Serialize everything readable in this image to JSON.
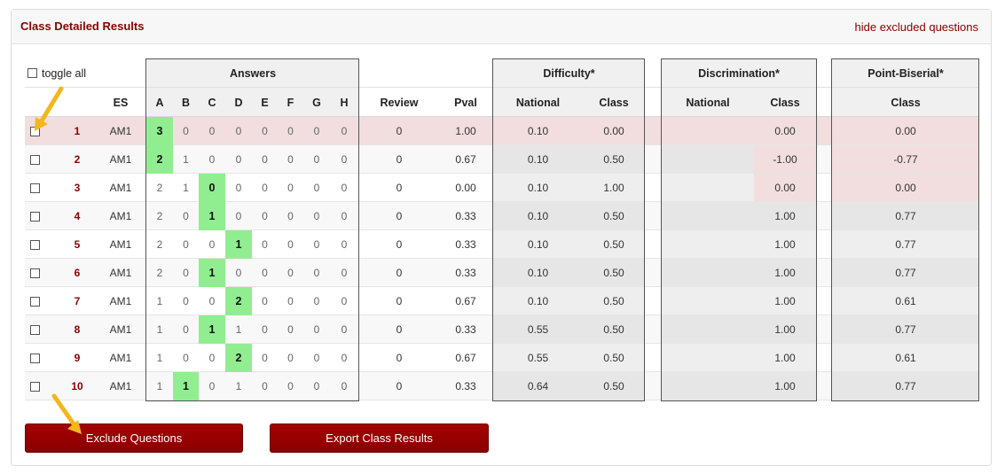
{
  "panel": {
    "title": "Class Detailed Results",
    "hide_link": "hide excluded questions"
  },
  "toggle_all": "toggle all",
  "groups": {
    "answers": "Answers",
    "difficulty": "Difficulty*",
    "discrimination": "Discrimination*",
    "point_biserial": "Point-Biserial*"
  },
  "columns": {
    "es": "ES",
    "answer_letters": [
      "A",
      "B",
      "C",
      "D",
      "E",
      "F",
      "G",
      "H"
    ],
    "review": "Review",
    "pval": "Pval",
    "difficulty_national": "National",
    "difficulty_class": "Class",
    "discrimination_national": "National",
    "discrimination_class": "Class",
    "pb_class": "Class"
  },
  "rows": [
    {
      "num": "1",
      "es": "AM1",
      "answers": [
        "3",
        "0",
        "0",
        "0",
        "0",
        "0",
        "0",
        "0"
      ],
      "correct": 0,
      "review": "0",
      "pval": "1.00",
      "diff_nat": "0.10",
      "diff_class": "0.00",
      "disc_nat": "",
      "disc_class": "0.00",
      "pb": "0.00",
      "excluded": true
    },
    {
      "num": "2",
      "es": "AM1",
      "answers": [
        "2",
        "1",
        "0",
        "0",
        "0",
        "0",
        "0",
        "0"
      ],
      "correct": 0,
      "review": "0",
      "pval": "0.67",
      "diff_nat": "0.10",
      "diff_class": "0.50",
      "disc_nat": "",
      "disc_class": "-1.00",
      "pb": "-0.77",
      "excluded": false,
      "flag_disc": true
    },
    {
      "num": "3",
      "es": "AM1",
      "answers": [
        "2",
        "1",
        "0",
        "0",
        "0",
        "0",
        "0",
        "0"
      ],
      "correct": 2,
      "review": "0",
      "pval": "0.00",
      "diff_nat": "0.10",
      "diff_class": "1.00",
      "disc_nat": "",
      "disc_class": "0.00",
      "pb": "0.00",
      "excluded": false,
      "flag_disc": true
    },
    {
      "num": "4",
      "es": "AM1",
      "answers": [
        "2",
        "0",
        "1",
        "0",
        "0",
        "0",
        "0",
        "0"
      ],
      "correct": 2,
      "review": "0",
      "pval": "0.33",
      "diff_nat": "0.10",
      "diff_class": "0.50",
      "disc_nat": "",
      "disc_class": "1.00",
      "pb": "0.77",
      "excluded": false
    },
    {
      "num": "5",
      "es": "AM1",
      "answers": [
        "2",
        "0",
        "0",
        "1",
        "0",
        "0",
        "0",
        "0"
      ],
      "correct": 3,
      "review": "0",
      "pval": "0.33",
      "diff_nat": "0.10",
      "diff_class": "0.50",
      "disc_nat": "",
      "disc_class": "1.00",
      "pb": "0.77",
      "excluded": false
    },
    {
      "num": "6",
      "es": "AM1",
      "answers": [
        "2",
        "0",
        "1",
        "0",
        "0",
        "0",
        "0",
        "0"
      ],
      "correct": 2,
      "review": "0",
      "pval": "0.33",
      "diff_nat": "0.10",
      "diff_class": "0.50",
      "disc_nat": "",
      "disc_class": "1.00",
      "pb": "0.77",
      "excluded": false
    },
    {
      "num": "7",
      "es": "AM1",
      "answers": [
        "1",
        "0",
        "0",
        "2",
        "0",
        "0",
        "0",
        "0"
      ],
      "correct": 3,
      "review": "0",
      "pval": "0.67",
      "diff_nat": "0.10",
      "diff_class": "0.50",
      "disc_nat": "",
      "disc_class": "1.00",
      "pb": "0.61",
      "excluded": false
    },
    {
      "num": "8",
      "es": "AM1",
      "answers": [
        "1",
        "0",
        "1",
        "1",
        "0",
        "0",
        "0",
        "0"
      ],
      "correct": 2,
      "review": "0",
      "pval": "0.33",
      "diff_nat": "0.55",
      "diff_class": "0.50",
      "disc_nat": "",
      "disc_class": "1.00",
      "pb": "0.77",
      "excluded": false
    },
    {
      "num": "9",
      "es": "AM1",
      "answers": [
        "1",
        "0",
        "0",
        "2",
        "0",
        "0",
        "0",
        "0"
      ],
      "correct": 3,
      "review": "0",
      "pval": "0.67",
      "diff_nat": "0.55",
      "diff_class": "0.50",
      "disc_nat": "",
      "disc_class": "1.00",
      "pb": "0.61",
      "excluded": false
    },
    {
      "num": "10",
      "es": "AM1",
      "answers": [
        "1",
        "1",
        "0",
        "1",
        "0",
        "0",
        "0",
        "0"
      ],
      "correct": 1,
      "review": "0",
      "pval": "0.33",
      "diff_nat": "0.64",
      "diff_class": "0.50",
      "disc_nat": "",
      "disc_class": "1.00",
      "pb": "0.77",
      "excluded": false
    }
  ],
  "buttons": {
    "exclude": "Exclude Questions",
    "export": "Export Class Results"
  },
  "colors": {
    "accent": "#8b0000",
    "correct_green": "#90ee90",
    "excluded_pink": "#f2dede",
    "shaded_gray": "#eeeeee",
    "arrow_yellow": "#f3b71b"
  },
  "icons": [
    "checkbox-icon",
    "arrow-pointer-icon"
  ]
}
